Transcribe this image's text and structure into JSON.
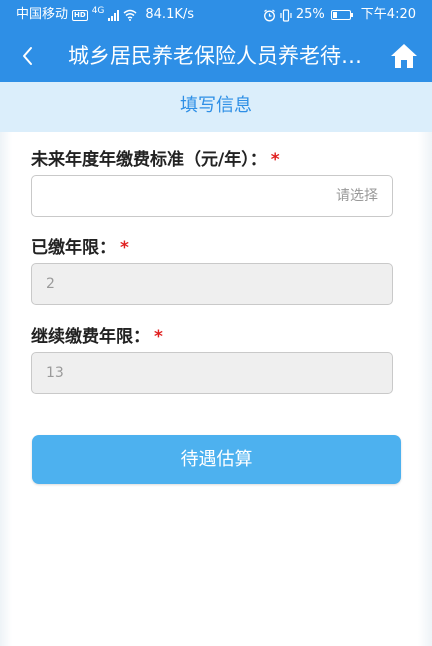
{
  "status_bar": {
    "carrier": "中国移动",
    "network_badge": "HD",
    "network_type": "4G",
    "speed": "84.1K/s",
    "battery": "25%",
    "time": "下午4:20",
    "battery_level": 0.25
  },
  "nav": {
    "title": "城乡居民养老保险人员养老待遇估算",
    "back_icon": "chevron-left-icon",
    "home_icon": "home-icon"
  },
  "section": {
    "title": "填写信息"
  },
  "form": {
    "future_fee_label": "未来年度年缴费标准（元/年）：",
    "future_fee_placeholder": "请选择",
    "paid_years_label": "已缴年限：",
    "paid_years_value": "2",
    "continue_years_label": "继续缴费年限：",
    "continue_years_value": "13",
    "required_mark": "*"
  },
  "actions": {
    "estimate_label": "待遇估算"
  },
  "colors": {
    "primary": "#2e8fe6",
    "button": "#4db1ef",
    "required": "#e02020",
    "section_bg": "#dbeefb"
  }
}
